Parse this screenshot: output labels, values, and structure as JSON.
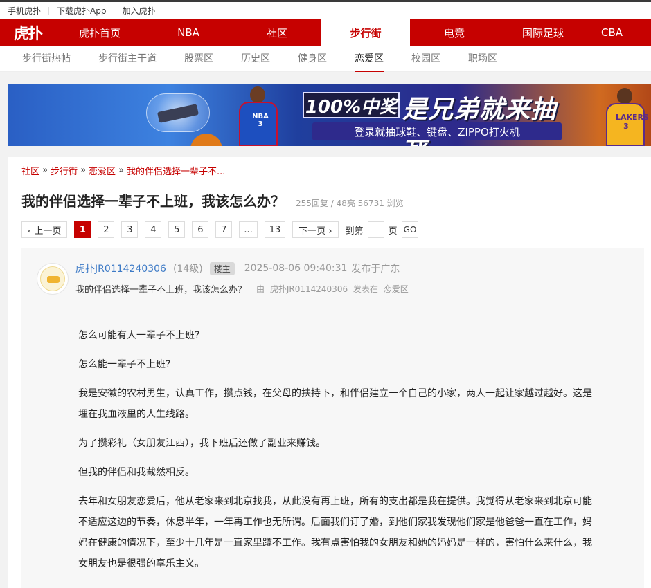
{
  "topbar": {
    "links": [
      "手机虎扑",
      "下载虎扑App",
      "加入虎扑"
    ]
  },
  "mainnav": {
    "logo": "虎扑",
    "items": [
      "虎扑首页",
      "NBA",
      "社区",
      "步行街",
      "电竞",
      "国际足球",
      "CBA"
    ],
    "active": "步行街"
  },
  "subnav": {
    "items": [
      "步行街热帖",
      "步行街主干道",
      "股票区",
      "历史区",
      "健身区",
      "恋爱区",
      "校园区",
      "职场区"
    ],
    "active": "恋爱区"
  },
  "banner": {
    "badge": "100%中奖",
    "headline": "是兄弟就来抽我",
    "subline": "登录就抽球鞋、键盘、ZIPPO打火机",
    "jersey1": "NBA 3",
    "jersey2": "LAKERS 3"
  },
  "breadcrumb": [
    "社区",
    "步行街",
    "恋爱区",
    "我的伴侣选择一辈子不..."
  ],
  "post": {
    "title": "我的伴侣选择一辈子不上班，我该怎么办？",
    "stats": "255回复 / 48亮  56731 浏览",
    "author": "虎扑JR0114240306",
    "level": "(14级)",
    "owner_badge": "楼主",
    "time": "2025-08-06 09:40:31",
    "location": "发布于广东",
    "subtitle": "我的伴侣选择一辈子不上班，我该怎么办？",
    "meta_by": "由",
    "meta_author": "虎扑JR0114240306",
    "meta_posted": "发表在",
    "meta_board": "恋爱区",
    "paragraphs": [
      "怎么可能有人一辈子不上班?",
      "怎么能一辈子不上班?",
      "我是安徽的农村男生，认真工作，攒点钱，在父母的扶持下，和伴侣建立一个自己的小家，两人一起让家越过越好。这是埋在我血液里的人生线路。",
      "为了攒彩礼（女朋友江西），我下班后还做了副业来赚钱。",
      "但我的伴侣和我截然相反。",
      "去年和女朋友恋爱后，他从老家来到北京找我，从此没有再上班，所有的支出都是我在提供。我觉得从老家来到北京可能不适应这边的节奏，休息半年，一年再工作也无所谓。后面我们订了婚，到他们家我发现他们家是他爸爸一直在工作，妈妈在健康的情况下，至少十几年是一直家里蹲不工作。我有点害怕我的女朋友和她的妈妈是一样的，害怕什么来什么，我女朋友也是很强的享乐主义。"
    ]
  },
  "pager": {
    "prev": "‹ 上一页",
    "pages": [
      "1",
      "2",
      "3",
      "4",
      "5",
      "6",
      "7",
      "...",
      "13"
    ],
    "current": "1",
    "next": "下一页 ›",
    "goto_label": "到第",
    "goto_page": "页",
    "go": "GO"
  },
  "colors": {
    "brand": "#c60100",
    "author_link": "#3d7ac6"
  }
}
